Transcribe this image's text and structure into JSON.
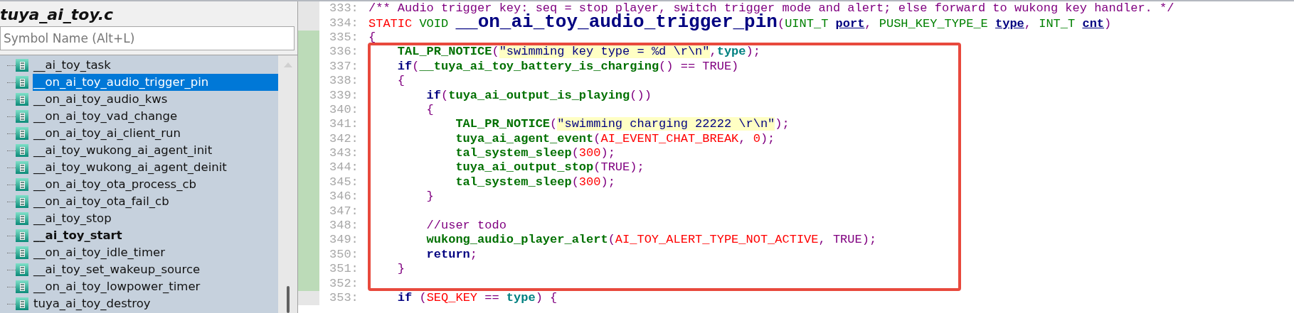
{
  "sidebar": {
    "title": "tuya_ai_toy.c",
    "search": {
      "placeholder": "Symbol Name (Alt+L)"
    },
    "items": [
      {
        "label": "__ai_toy_task",
        "selected": false,
        "bold": false
      },
      {
        "label": "__on_ai_toy_audio_trigger_pin",
        "selected": true,
        "bold": false
      },
      {
        "label": "__on_ai_toy_audio_kws",
        "selected": false,
        "bold": false
      },
      {
        "label": "__on_ai_toy_vad_change",
        "selected": false,
        "bold": false
      },
      {
        "label": "__on_ai_toy_ai_client_run",
        "selected": false,
        "bold": false
      },
      {
        "label": "__ai_toy_wukong_ai_agent_init",
        "selected": false,
        "bold": false
      },
      {
        "label": "__ai_toy_wukong_ai_agent_deinit",
        "selected": false,
        "bold": false
      },
      {
        "label": "__on_ai_toy_ota_process_cb",
        "selected": false,
        "bold": false
      },
      {
        "label": "__on_ai_toy_ota_fail_cb",
        "selected": false,
        "bold": false
      },
      {
        "label": "__ai_toy_stop",
        "selected": false,
        "bold": false
      },
      {
        "label": "__ai_toy_start",
        "selected": false,
        "bold": true
      },
      {
        "label": "__on_ai_toy_idle_timer",
        "selected": false,
        "bold": false
      },
      {
        "label": "__ai_toy_set_wakeup_source",
        "selected": false,
        "bold": false
      },
      {
        "label": "__on_ai_toy_lowpower_timer",
        "selected": false,
        "bold": false
      },
      {
        "label": "tuya_ai_toy_destroy",
        "selected": false,
        "bold": false
      }
    ]
  },
  "editor": {
    "lines": [
      {
        "number": "333:",
        "changed": false,
        "tokens": [
          {
            "kind": "comment",
            "text": "/** Audio trigger key: seq = stop player, switch trigger mode and alert; else forward to wukong key handler. */"
          }
        ]
      },
      {
        "number": "334:",
        "changed": false,
        "tokens": [
          {
            "kind": "macro",
            "text": "STATIC "
          },
          {
            "kind": "type",
            "text": "VOID "
          },
          {
            "kind": "def",
            "text": "__on_ai_toy_audio_trigger_pin"
          },
          {
            "kind": "punct",
            "text": "("
          },
          {
            "kind": "type",
            "text": "UINT_T "
          },
          {
            "kind": "param",
            "text": "port"
          },
          {
            "kind": "punct",
            "text": ", "
          },
          {
            "kind": "type",
            "text": "PUSH_KEY_TYPE_E "
          },
          {
            "kind": "param",
            "text": "type"
          },
          {
            "kind": "punct",
            "text": ", "
          },
          {
            "kind": "type",
            "text": "INT_T "
          },
          {
            "kind": "param",
            "text": "cnt"
          },
          {
            "kind": "punct",
            "text": ")"
          }
        ]
      },
      {
        "number": "335:",
        "changed": true,
        "tokens": [
          {
            "kind": "punct",
            "text": "{"
          }
        ]
      },
      {
        "number": "336:",
        "changed": true,
        "tokens": [
          {
            "kind": "func",
            "text": "    TAL_PR_NOTICE"
          },
          {
            "kind": "punct",
            "text": "("
          },
          {
            "kind": "string",
            "text": "\"swimming key type = %d \\r\\n\""
          },
          {
            "kind": "punct",
            "text": ","
          },
          {
            "kind": "var",
            "text": "type"
          },
          {
            "kind": "punct",
            "text": ");"
          }
        ]
      },
      {
        "number": "337:",
        "changed": true,
        "tokens": [
          {
            "kind": "keyword",
            "text": "    if"
          },
          {
            "kind": "punct",
            "text": "("
          },
          {
            "kind": "func",
            "text": "__tuya_ai_toy_battery_is_charging"
          },
          {
            "kind": "punct",
            "text": "() == "
          },
          {
            "kind": "const",
            "text": "TRUE"
          },
          {
            "kind": "punct",
            "text": ")"
          }
        ]
      },
      {
        "number": "338:",
        "changed": true,
        "tokens": [
          {
            "kind": "punct",
            "text": "    {"
          }
        ]
      },
      {
        "number": "339:",
        "changed": true,
        "tokens": [
          {
            "kind": "keyword",
            "text": "        if"
          },
          {
            "kind": "punct",
            "text": "("
          },
          {
            "kind": "func",
            "text": "tuya_ai_output_is_playing"
          },
          {
            "kind": "punct",
            "text": "())"
          }
        ]
      },
      {
        "number": "340:",
        "changed": true,
        "tokens": [
          {
            "kind": "punct",
            "text": "        {"
          }
        ]
      },
      {
        "number": "341:",
        "changed": true,
        "tokens": [
          {
            "kind": "func",
            "text": "            TAL_PR_NOTICE"
          },
          {
            "kind": "punct",
            "text": "("
          },
          {
            "kind": "string",
            "text": "\"swimming charging 22222 \\r\\n\""
          },
          {
            "kind": "punct",
            "text": ");"
          }
        ]
      },
      {
        "number": "342:",
        "changed": true,
        "tokens": [
          {
            "kind": "func",
            "text": "            tuya_ai_agent_event"
          },
          {
            "kind": "punct",
            "text": "("
          },
          {
            "kind": "macro",
            "text": "AI_EVENT_CHAT_BREAK"
          },
          {
            "kind": "punct",
            "text": ", "
          },
          {
            "kind": "macro",
            "text": "0"
          },
          {
            "kind": "punct",
            "text": ");"
          }
        ]
      },
      {
        "number": "343:",
        "changed": true,
        "tokens": [
          {
            "kind": "func",
            "text": "            tal_system_sleep"
          },
          {
            "kind": "punct",
            "text": "("
          },
          {
            "kind": "macro",
            "text": "300"
          },
          {
            "kind": "punct",
            "text": ");"
          }
        ]
      },
      {
        "number": "344:",
        "changed": true,
        "tokens": [
          {
            "kind": "func",
            "text": "            tuya_ai_output_stop"
          },
          {
            "kind": "punct",
            "text": "("
          },
          {
            "kind": "const",
            "text": "TRUE"
          },
          {
            "kind": "punct",
            "text": ");"
          }
        ]
      },
      {
        "number": "345:",
        "changed": true,
        "tokens": [
          {
            "kind": "func",
            "text": "            tal_system_sleep"
          },
          {
            "kind": "punct",
            "text": "("
          },
          {
            "kind": "macro",
            "text": "300"
          },
          {
            "kind": "punct",
            "text": ");"
          }
        ]
      },
      {
        "number": "346:",
        "changed": true,
        "tokens": [
          {
            "kind": "punct",
            "text": "        }"
          }
        ]
      },
      {
        "number": "347:",
        "changed": true
      },
      {
        "number": "348:",
        "changed": true,
        "tokens": [
          {
            "kind": "comment",
            "text": "        //user todo"
          }
        ]
      },
      {
        "number": "349:",
        "changed": true,
        "tokens": [
          {
            "kind": "func",
            "text": "        wukong_audio_player_alert"
          },
          {
            "kind": "punct",
            "text": "("
          },
          {
            "kind": "macro",
            "text": "AI_TOY_ALERT_TYPE_NOT_ACTIVE"
          },
          {
            "kind": "punct",
            "text": ", "
          },
          {
            "kind": "const",
            "text": "TRUE"
          },
          {
            "kind": "punct",
            "text": ");"
          }
        ]
      },
      {
        "number": "350:",
        "changed": true,
        "tokens": [
          {
            "kind": "keyword",
            "text": "        return"
          },
          {
            "kind": "punct",
            "text": ";"
          }
        ]
      },
      {
        "number": "351:",
        "changed": true,
        "tokens": [
          {
            "kind": "punct",
            "text": "    }"
          }
        ]
      },
      {
        "number": "352:",
        "changed": true
      },
      {
        "number": "353:",
        "changed": false,
        "tokens": [
          {
            "kind": "keyword",
            "text": "    if"
          },
          {
            "kind": "punct",
            "text": " ("
          },
          {
            "kind": "macro",
            "text": "SEQ_KEY"
          },
          {
            "kind": "punct",
            "text": " == "
          },
          {
            "kind": "var",
            "text": "type"
          },
          {
            "kind": "punct",
            "text": ") {"
          }
        ]
      }
    ]
  }
}
